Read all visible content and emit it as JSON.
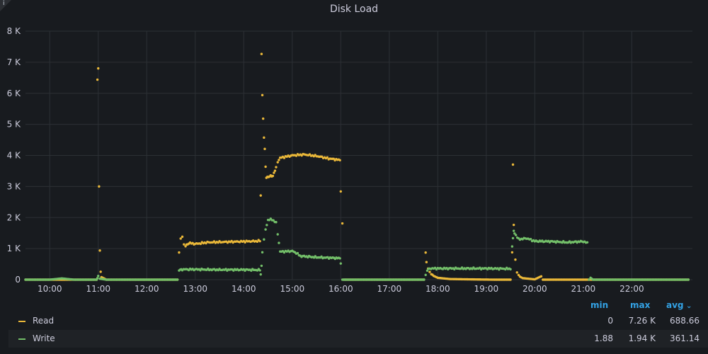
{
  "panel": {
    "title": "Disk Load",
    "info_icon": "info-icon"
  },
  "chart_data": {
    "type": "scatter",
    "title": "Disk Load",
    "xlabel": "",
    "ylabel": "",
    "x_range": [
      "09:30",
      "23:15"
    ],
    "ylim": [
      0,
      8000
    ],
    "x_ticks": [
      "10:00",
      "11:00",
      "12:00",
      "13:00",
      "14:00",
      "15:00",
      "16:00",
      "17:00",
      "18:00",
      "19:00",
      "20:00",
      "21:00",
      "22:00"
    ],
    "y_ticks": [
      "0",
      "1 K",
      "2 K",
      "3 K",
      "4 K",
      "5 K",
      "6 K",
      "7 K",
      "8 K"
    ],
    "grid": true,
    "legend_placement": "bottom",
    "series": [
      {
        "name": "Read",
        "color": "#eab839",
        "points": [
          [
            "09:30",
            0
          ],
          [
            "10:00",
            0
          ],
          [
            "10:30",
            0
          ],
          [
            "10:58",
            0
          ],
          [
            "10:59",
            6430
          ],
          [
            "11:00",
            6820
          ],
          [
            "11:01",
            3020
          ],
          [
            "11:02",
            920
          ],
          [
            "11:03",
            230
          ],
          [
            "11:04",
            80
          ],
          [
            "11:10",
            0
          ],
          [
            "11:40",
            0
          ],
          [
            "12:10",
            0
          ],
          [
            "12:38",
            0
          ],
          [
            "12:40",
            880
          ],
          [
            "12:42",
            1300
          ],
          [
            "12:44",
            1410
          ],
          [
            "12:46",
            1120
          ],
          [
            "12:48",
            1080
          ],
          [
            "12:52",
            1180
          ],
          [
            "13:00",
            1150
          ],
          [
            "13:15",
            1200
          ],
          [
            "13:30",
            1210
          ],
          [
            "13:45",
            1220
          ],
          [
            "14:00",
            1230
          ],
          [
            "14:15",
            1240
          ],
          [
            "14:20",
            1250
          ],
          [
            "14:21",
            2720
          ],
          [
            "14:22",
            7260
          ],
          [
            "14:23",
            5950
          ],
          [
            "14:24",
            5200
          ],
          [
            "14:25",
            4560
          ],
          [
            "14:26",
            4180
          ],
          [
            "14:27",
            3640
          ],
          [
            "14:28",
            3300
          ],
          [
            "14:32",
            3320
          ],
          [
            "14:36",
            3350
          ],
          [
            "14:40",
            3600
          ],
          [
            "14:42",
            3800
          ],
          [
            "14:45",
            3920
          ],
          [
            "15:00",
            4000
          ],
          [
            "15:15",
            4030
          ],
          [
            "15:30",
            3980
          ],
          [
            "15:45",
            3900
          ],
          [
            "15:59",
            3850
          ],
          [
            "16:00",
            2870
          ],
          [
            "16:02",
            1790
          ],
          [
            "16:04",
            0
          ],
          [
            "16:30",
            0
          ],
          [
            "17:00",
            0
          ],
          [
            "17:30",
            0
          ],
          [
            "17:43",
            0
          ],
          [
            "17:45",
            870
          ],
          [
            "17:46",
            560
          ],
          [
            "17:48",
            350
          ],
          [
            "17:50",
            250
          ],
          [
            "17:52",
            180
          ],
          [
            "17:55",
            120
          ],
          [
            "18:00",
            60
          ],
          [
            "18:15",
            20
          ],
          [
            "18:40",
            10
          ],
          [
            "19:10",
            0
          ],
          [
            "19:30",
            0
          ],
          [
            "19:32",
            860
          ],
          [
            "19:33",
            3680
          ],
          [
            "19:34",
            1770
          ],
          [
            "19:36",
            640
          ],
          [
            "19:38",
            250
          ],
          [
            "19:40",
            120
          ],
          [
            "19:45",
            50
          ],
          [
            "20:00",
            10
          ],
          [
            "20:08",
            110
          ],
          [
            "20:10",
            0
          ],
          [
            "20:40",
            0
          ],
          [
            "21:10",
            0
          ],
          [
            "21:40",
            0
          ],
          [
            "22:10",
            0
          ],
          [
            "22:40",
            0
          ],
          [
            "23:10",
            0
          ]
        ]
      },
      {
        "name": "Write",
        "color": "#73bf69",
        "points": [
          [
            "09:30",
            0
          ],
          [
            "10:00",
            0
          ],
          [
            "10:15",
            40
          ],
          [
            "10:30",
            0
          ],
          [
            "10:58",
            0
          ],
          [
            "10:59",
            50
          ],
          [
            "11:00",
            140
          ],
          [
            "11:02",
            30
          ],
          [
            "11:10",
            0
          ],
          [
            "11:40",
            0
          ],
          [
            "12:10",
            0
          ],
          [
            "12:38",
            0
          ],
          [
            "12:40",
            300
          ],
          [
            "12:44",
            330
          ],
          [
            "13:00",
            330
          ],
          [
            "13:30",
            320
          ],
          [
            "14:00",
            320
          ],
          [
            "14:20",
            310
          ],
          [
            "14:21",
            180
          ],
          [
            "14:22",
            440
          ],
          [
            "14:23",
            890
          ],
          [
            "14:25",
            1280
          ],
          [
            "14:27",
            1620
          ],
          [
            "14:30",
            1920
          ],
          [
            "14:35",
            1940
          ],
          [
            "14:40",
            1830
          ],
          [
            "14:42",
            1480
          ],
          [
            "14:45",
            900
          ],
          [
            "15:00",
            920
          ],
          [
            "15:05",
            860
          ],
          [
            "15:10",
            760
          ],
          [
            "15:30",
            720
          ],
          [
            "15:50",
            700
          ],
          [
            "15:59",
            690
          ],
          [
            "16:00",
            550
          ],
          [
            "16:02",
            0
          ],
          [
            "16:30",
            0
          ],
          [
            "17:00",
            0
          ],
          [
            "17:30",
            0
          ],
          [
            "17:43",
            0
          ],
          [
            "17:45",
            150
          ],
          [
            "17:47",
            300
          ],
          [
            "17:50",
            360
          ],
          [
            "18:00",
            360
          ],
          [
            "18:30",
            360
          ],
          [
            "19:00",
            360
          ],
          [
            "19:30",
            350
          ],
          [
            "19:32",
            1050
          ],
          [
            "19:33",
            1310
          ],
          [
            "19:34",
            1580
          ],
          [
            "19:35",
            1500
          ],
          [
            "19:40",
            1300
          ],
          [
            "19:50",
            1330
          ],
          [
            "20:00",
            1240
          ],
          [
            "20:20",
            1230
          ],
          [
            "20:40",
            1200
          ],
          [
            "21:00",
            1230
          ],
          [
            "21:05",
            1180
          ],
          [
            "21:07",
            0
          ],
          [
            "21:09",
            60
          ],
          [
            "21:12",
            0
          ],
          [
            "21:40",
            0
          ],
          [
            "22:10",
            0
          ],
          [
            "22:40",
            0
          ],
          [
            "23:10",
            0
          ]
        ]
      }
    ],
    "legend": {
      "headers": {
        "min": "min",
        "max": "max",
        "avg": "avg"
      },
      "sort_icon": "chevron-down-icon",
      "rows": [
        {
          "name": "Read",
          "min": "0",
          "max": "7.26 K",
          "avg": "688.66"
        },
        {
          "name": "Write",
          "min": "1.88",
          "max": "1.94 K",
          "avg": "361.14"
        }
      ]
    }
  }
}
